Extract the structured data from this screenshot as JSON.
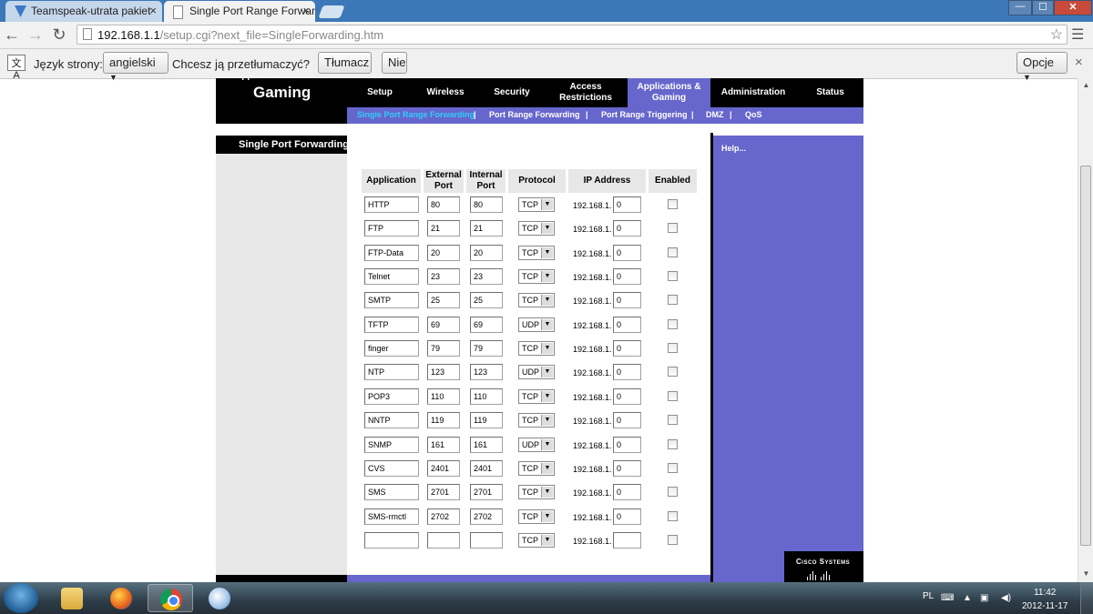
{
  "browser": {
    "tabs": [
      {
        "label": "Teamspeak-utrata pakiet",
        "active": false
      },
      {
        "label": "Single Port Range Forwar",
        "active": true
      }
    ],
    "url_host": "192.168.1.1",
    "url_path": "/setup.cgi?next_file=SingleForwarding.htm",
    "window_buttons": {
      "minimize": "—",
      "maximize": "☐",
      "close": "✕"
    }
  },
  "translate_bar": {
    "page_language_label": "Język strony:",
    "language_value": "angielski",
    "question": "Chcesz ją przetłumaczyć?",
    "translate_button": "Tłumacz",
    "no_button": "Nie",
    "options_button": "Opcje"
  },
  "router": {
    "brand": "Gaming",
    "brand_fragment": "Applications &",
    "main_nav": [
      "Setup",
      "Wireless",
      "Security",
      "Access Restrictions",
      "Applications & Gaming",
      "Administration",
      "Status"
    ],
    "active_nav": "Applications & Gaming",
    "sub_nav": [
      "Single Port Range Forwarding",
      "Port Range Forwarding",
      "Port Range Triggering",
      "DMZ",
      "QoS"
    ],
    "sub_nav_separator": "|",
    "page_title": "Single Port Forwarding",
    "help_link": "Help...",
    "vendor_logo": "Cisco Systems",
    "table_headers": [
      "Application",
      "External Port",
      "Internal Port",
      "Protocol",
      "IP Address",
      "Enabled"
    ],
    "ip_prefix": "192.168.1.",
    "rows": [
      {
        "app": "HTTP",
        "ext": "80",
        "int": "80",
        "proto": "TCP",
        "ip": "0",
        "enabled": false
      },
      {
        "app": "FTP",
        "ext": "21",
        "int": "21",
        "proto": "TCP",
        "ip": "0",
        "enabled": false
      },
      {
        "app": "FTP-Data",
        "ext": "20",
        "int": "20",
        "proto": "TCP",
        "ip": "0",
        "enabled": false
      },
      {
        "app": "Telnet",
        "ext": "23",
        "int": "23",
        "proto": "TCP",
        "ip": "0",
        "enabled": false
      },
      {
        "app": "SMTP",
        "ext": "25",
        "int": "25",
        "proto": "TCP",
        "ip": "0",
        "enabled": false
      },
      {
        "app": "TFTP",
        "ext": "69",
        "int": "69",
        "proto": "UDP",
        "ip": "0",
        "enabled": false
      },
      {
        "app": "finger",
        "ext": "79",
        "int": "79",
        "proto": "TCP",
        "ip": "0",
        "enabled": false
      },
      {
        "app": "NTP",
        "ext": "123",
        "int": "123",
        "proto": "UDP",
        "ip": "0",
        "enabled": false
      },
      {
        "app": "POP3",
        "ext": "110",
        "int": "110",
        "proto": "TCP",
        "ip": "0",
        "enabled": false
      },
      {
        "app": "NNTP",
        "ext": "119",
        "int": "119",
        "proto": "TCP",
        "ip": "0",
        "enabled": false
      },
      {
        "app": "SNMP",
        "ext": "161",
        "int": "161",
        "proto": "UDP",
        "ip": "0",
        "enabled": false
      },
      {
        "app": "CVS",
        "ext": "2401",
        "int": "2401",
        "proto": "TCP",
        "ip": "0",
        "enabled": false
      },
      {
        "app": "SMS",
        "ext": "2701",
        "int": "2701",
        "proto": "TCP",
        "ip": "0",
        "enabled": false
      },
      {
        "app": "SMS-rmctl",
        "ext": "2702",
        "int": "2702",
        "proto": "TCP",
        "ip": "0",
        "enabled": false
      },
      {
        "app": "",
        "ext": "",
        "int": "",
        "proto": "TCP",
        "ip": "",
        "enabled": false
      }
    ]
  },
  "taskbar": {
    "apps": [
      "windows-explorer-icon",
      "firefox-icon",
      "chrome-icon",
      "paint-icon"
    ],
    "language": "PL",
    "time": "11:42",
    "date": "2012-11-17"
  },
  "colors": {
    "cisco_purple": "#6666cc",
    "active_subnav_link": "#33ccff",
    "chrome_frame": "#3c78b8"
  }
}
